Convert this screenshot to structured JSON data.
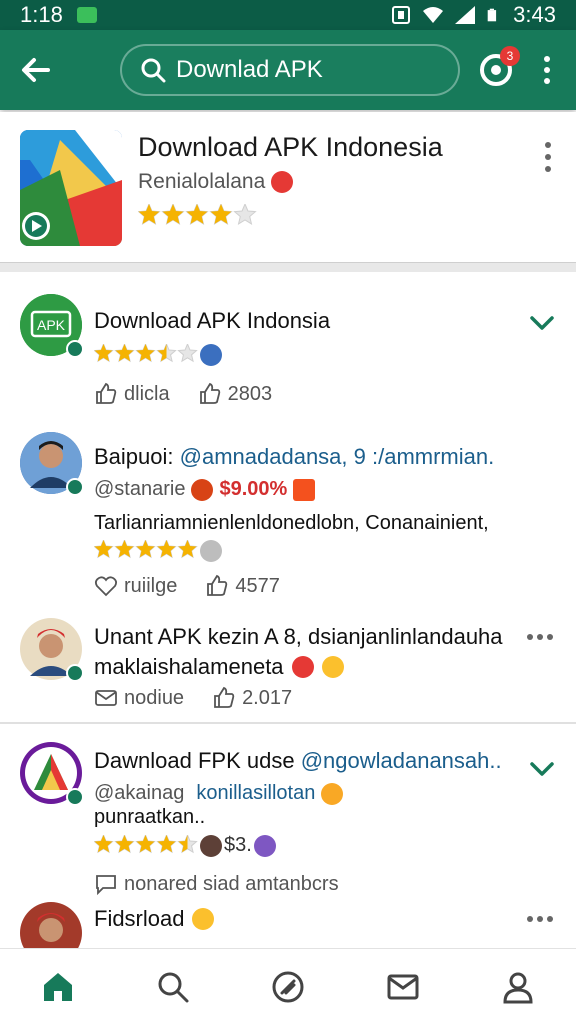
{
  "status_bar": {
    "time_left": "1:18",
    "time_right": "3:43"
  },
  "app_bar": {
    "search_text": "Downlad APK",
    "badge_count": "3"
  },
  "app_header": {
    "title": "Download APK Indonesia",
    "developer": "Renialolalana",
    "rating": 4
  },
  "feed": [
    {
      "title": "Download APK Indonsia",
      "rating": 3.5,
      "like_label": "dlicla",
      "count": "2803"
    },
    {
      "author": "Baipuoi:",
      "mention": "@amnadadansa, 9 :/ammrmian.",
      "handle": "@stanarie",
      "price": "$9.00%",
      "body": "Tarlianriamnienlenldonedlobn, Conanainient,",
      "rating": 5,
      "like_label": "ruiilge",
      "count": "4577"
    },
    {
      "body1": "Unant APK kezin A 8, dsianjanlinlandauha",
      "body2": "maklaishalameneta",
      "like_label": "nodiue",
      "count": "2.017"
    },
    {
      "title": "Dawnload FPK udse",
      "mention": "@ngowladanansah..",
      "handle": "@akainag",
      "link": "konillasillotan",
      "body": "punraatkan..",
      "rating": 4.5,
      "price": "$3.",
      "comment_label": "nonared siad amtanbcrs"
    },
    {
      "title": "Fidsrload"
    }
  ]
}
